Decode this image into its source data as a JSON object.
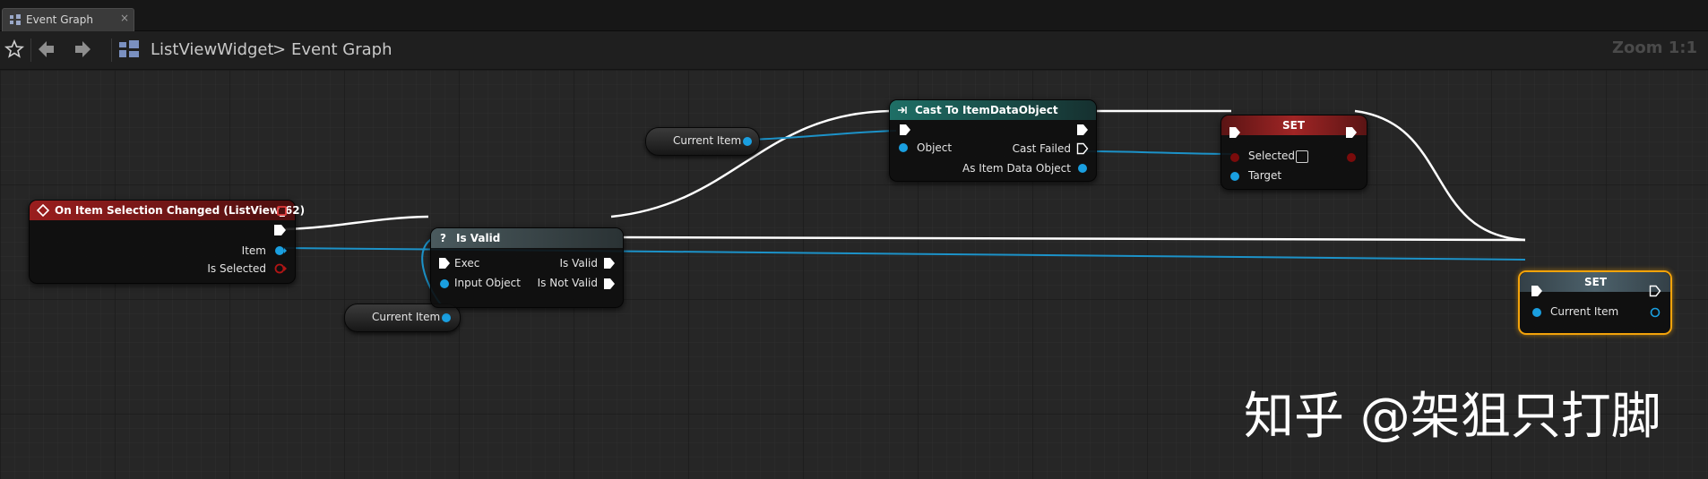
{
  "tab": {
    "label": "Event Graph"
  },
  "toolbar": {
    "breadcrumb_root": "ListViewWidget",
    "breadcrumb_sep": ">",
    "breadcrumb_current": "Event Graph",
    "zoom": "Zoom 1:1"
  },
  "nodes": {
    "event": {
      "title": "On Item Selection Changed (ListView_62)",
      "item": "Item",
      "is_selected": "Is Selected"
    },
    "is_valid": {
      "title": "Is Valid",
      "exec": "Exec",
      "input_object": "Input Object",
      "is_valid": "Is Valid",
      "is_not_valid": "Is Not Valid"
    },
    "cast": {
      "title": "Cast To ItemDataObject",
      "object": "Object",
      "cast_failed": "Cast Failed",
      "as_item": "As Item Data Object"
    },
    "set_selected": {
      "title": "SET",
      "selected": "Selected",
      "target": "Target"
    },
    "set_current": {
      "title": "SET",
      "current_item": "Current Item"
    },
    "var_top": {
      "label": "Current Item"
    },
    "var_bottom": {
      "label": "Current Item"
    }
  },
  "watermark": "知乎 @架狙只打脚",
  "colors": {
    "event_header": "#8a1a1a",
    "function_header": "#3d4a4d",
    "cast_header": "#1f6a60",
    "set_header": "#701c1c",
    "set_current_header": "#3c4d55",
    "object_pin": "#1a9fe0",
    "bool_pin": "#8e0d0d",
    "exec_pin": "#ffffff",
    "selection_outline": "#f4a30a"
  }
}
